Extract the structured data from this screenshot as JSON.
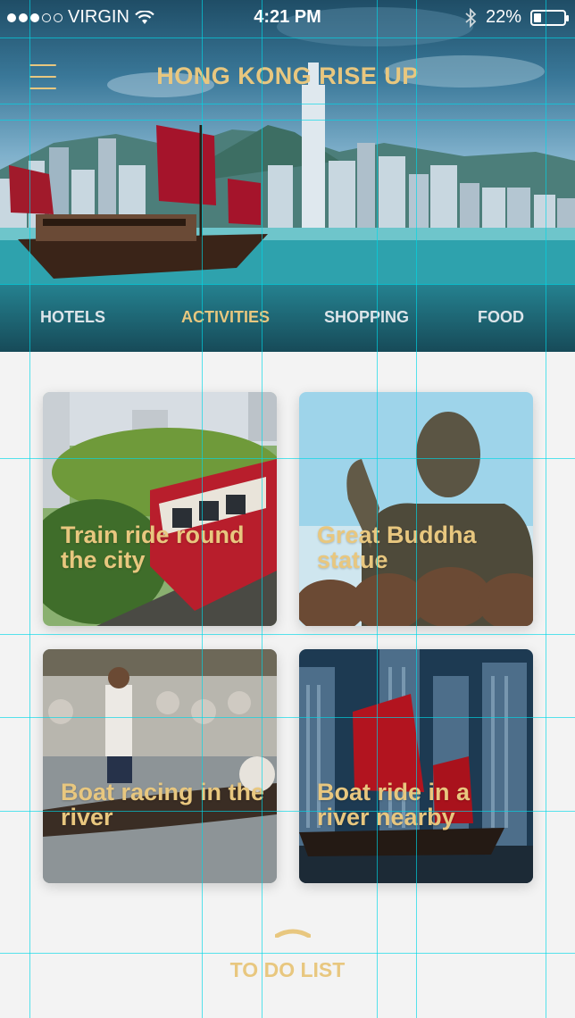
{
  "status_bar": {
    "carrier": "VIRGIN",
    "time": "4:21 PM",
    "battery": "22%",
    "battery_level": 0.22,
    "signal_dots": 5,
    "signal_filled": 3,
    "icons": [
      "wifi-icon",
      "bluetooth-icon",
      "battery-icon"
    ]
  },
  "header": {
    "title": "HONG KONG RISE UP",
    "menu_icon": "hamburger-menu-icon"
  },
  "tabs": [
    {
      "label": "HOTELS",
      "active": false
    },
    {
      "label": "ACTIVITIES",
      "active": true
    },
    {
      "label": "SHOPPING",
      "active": false
    },
    {
      "label": "FOOD",
      "active": false
    }
  ],
  "cards": [
    {
      "label": "Train ride round the city"
    },
    {
      "label": "Great Buddha statue"
    },
    {
      "label": "Boat racing in the river"
    },
    {
      "label": "Boat ride in a river nearby"
    }
  ],
  "todo": {
    "label": "TO DO LIST"
  },
  "colors": {
    "accent_gold": "#e8c77f",
    "background": "#f3f3f3",
    "tab_inactive": "#dde5ea",
    "guide_lines": "#00d7e6"
  }
}
